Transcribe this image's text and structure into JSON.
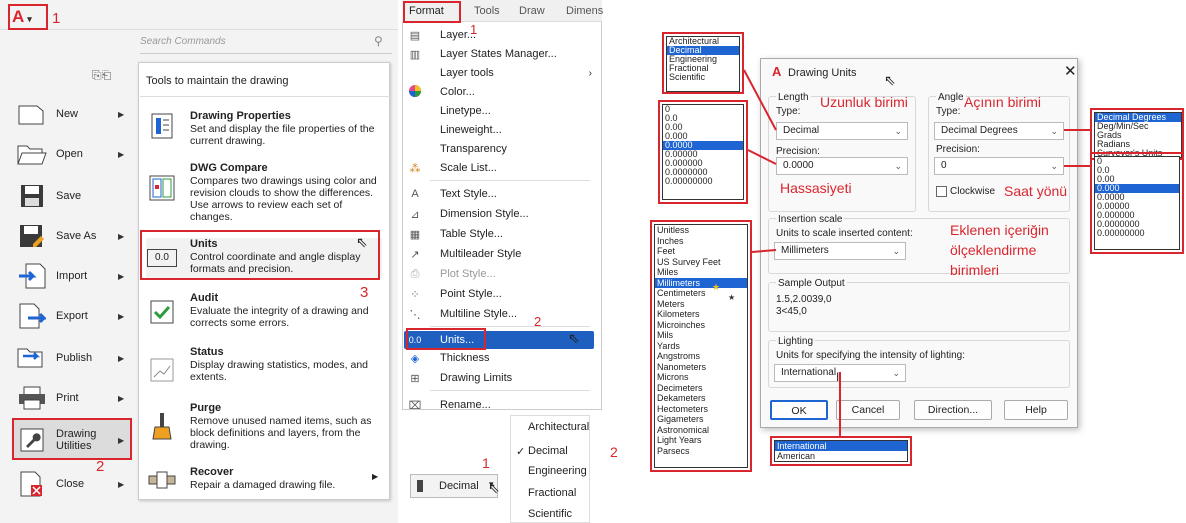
{
  "app_menu": {
    "app_letter": "A",
    "search_placeholder": "Search Commands",
    "nav": [
      {
        "label": "New"
      },
      {
        "label": "Open"
      },
      {
        "label": "Save"
      },
      {
        "label": "Save As"
      },
      {
        "label": "Import"
      },
      {
        "label": "Export"
      },
      {
        "label": "Publish"
      },
      {
        "label": "Print"
      },
      {
        "label": "Drawing Utilities"
      },
      {
        "label": "Close"
      }
    ],
    "submenu_header": "Tools to maintain the drawing",
    "submenu": [
      {
        "title": "Drawing Properties",
        "desc": "Set and display the file properties of the current drawing."
      },
      {
        "title": "DWG Compare",
        "desc": "Compares two drawings using color and revision clouds to show the differences. Use arrows to review each set of changes."
      },
      {
        "title": "Units",
        "desc": "Control coordinate and angle display formats and precision.",
        "icon_text": "0.0"
      },
      {
        "title": "Audit",
        "desc": "Evaluate the integrity of a drawing and corrects some errors."
      },
      {
        "title": "Status",
        "desc": "Display drawing statistics, modes, and extents."
      },
      {
        "title": "Purge",
        "desc": "Remove unused named items, such as block definitions and layers, from the drawing."
      },
      {
        "title": "Recover",
        "desc": "Repair a damaged drawing file."
      }
    ],
    "markers": [
      "1",
      "2",
      "3"
    ]
  },
  "format_menu": {
    "menubar": [
      "Format",
      "Tools",
      "Draw",
      "Dimens"
    ],
    "items": [
      {
        "label": "Layer..."
      },
      {
        "label": "Layer States Manager..."
      },
      {
        "label": "Layer tools"
      },
      {
        "label": "Color..."
      },
      {
        "label": "Linetype..."
      },
      {
        "label": "Lineweight..."
      },
      {
        "label": "Transparency"
      },
      {
        "label": "Scale List..."
      },
      {
        "label": "Text Style..."
      },
      {
        "label": "Dimension Style..."
      },
      {
        "label": "Table Style..."
      },
      {
        "label": "Multileader Style"
      },
      {
        "label": "Plot Style..."
      },
      {
        "label": "Point Style..."
      },
      {
        "label": "Multiline Style..."
      },
      {
        "label": "Units..."
      },
      {
        "label": "Thickness"
      },
      {
        "label": "Drawing Limits"
      },
      {
        "label": "Rename..."
      }
    ],
    "markers": [
      "1",
      "2"
    ]
  },
  "status_units": {
    "button": "Decimal",
    "options": [
      "Architectural",
      "Decimal",
      "Engineering",
      "Fractional",
      "Scientific"
    ],
    "checked": "Decimal",
    "markers": [
      "1",
      "2"
    ]
  },
  "dialog": {
    "title": "Drawing Units",
    "length_label": "Length",
    "type_label": "Type:",
    "angle_label": "Angle",
    "length_type": "Decimal",
    "angle_type": "Decimal Degrees",
    "precision_label": "Precision:",
    "length_precision": "0.0000",
    "angle_precision": "0",
    "clockwise": "Clockwise",
    "insertion_group": "Insertion scale",
    "insertion_label": "Units to scale inserted content:",
    "insertion_value": "Millimeters",
    "sample_group": "Sample Output",
    "sample_lines": [
      "1.5,2.0039,0",
      "3<45,0"
    ],
    "lighting_group": "Lighting",
    "lighting_label": "Units for specifying the intensity of lighting:",
    "lighting_value": "International",
    "buttons": [
      "OK",
      "Cancel",
      "Direction...",
      "Help"
    ]
  },
  "annotations": {
    "length_unit": "Uzunluk birimi",
    "angle_unit": "Açının birimi",
    "precision": "Hassasiyeti",
    "direction": "Saat yönü",
    "insert1": "Eklenen içeriğin",
    "insert2": "ölçeklendirme",
    "insert3": "birimleri"
  },
  "lists": {
    "length_types": [
      "Architectural",
      "Decimal",
      "Engineering",
      "Fractional",
      "Scientific"
    ],
    "length_precisions": [
      "0",
      "0.0",
      "0.00",
      "0.000",
      "0.0000",
      "0.00000",
      "0.000000",
      "0.0000000",
      "0.00000000"
    ],
    "angle_types": [
      "Decimal Degrees",
      "Deg/Min/Sec",
      "Grads",
      "Radians",
      "Surveyor's Units"
    ],
    "angle_precisions": [
      "0",
      "0.0",
      "0.00",
      "0.000",
      "0.0000",
      "0.00000",
      "0.000000",
      "0.0000000",
      "0.00000000"
    ],
    "insertion_units": [
      "Unitless",
      "Inches",
      "Feet",
      "US Survey Feet",
      "Miles",
      "Millimeters",
      "Centimeters",
      "Meters",
      "Kilometers",
      "Microinches",
      "Mils",
      "Yards",
      "Angstroms",
      "Nanometers",
      "Microns",
      "Decimeters",
      "Dekameters",
      "Hectometers",
      "Gigameters",
      "Astronomical",
      "Light Years",
      "Parsecs"
    ],
    "lighting_units": [
      "International",
      "American"
    ]
  },
  "colors": {
    "annotation_red": "#d9262e",
    "selection_blue": "#1e64d2"
  }
}
